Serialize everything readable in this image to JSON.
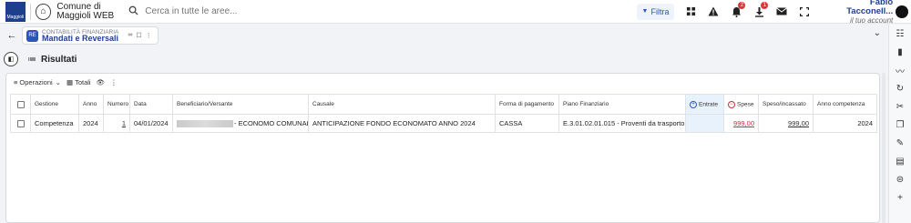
{
  "topbar": {
    "logo_text": "Maggioli",
    "app_title_line1": "Comune di",
    "app_title_line2": "Maggioli WEB",
    "search_placeholder": "Cerca in tutte le aree...",
    "filter_label": "Filtra",
    "notifications_badge": "2",
    "downloads_badge": "1",
    "user_name": "Fabio Tacconell...",
    "user_account": "il tuo account"
  },
  "tab": {
    "avatar": "RE",
    "subtitle": "CONTABILITÀ FINANZIARIA",
    "title": "Mandati e Reversali"
  },
  "results": {
    "title": "Risultati"
  },
  "toolbar": {
    "operations_label": "Operazioni",
    "totals_label": "Totali"
  },
  "table": {
    "headers": {
      "gestione": "Gestione",
      "anno": "Anno",
      "numero": "Numero",
      "data": "Data",
      "beneficiario": "Beneficiario/Versante",
      "causale": "Causale",
      "forma": "Forma di pagamento",
      "piano": "Piano Finanziario",
      "entrate": "Entrate",
      "spese": "Spese",
      "speso": "Speso/incassato",
      "anno_comp": "Anno competenza"
    },
    "rows": [
      {
        "gestione": "Competenza",
        "anno": "2024",
        "numero": "1",
        "data": "04/01/2024",
        "beneficiario": "- ECONOMO COMUNALE",
        "causale": "ANTICIPAZIONE FONDO ECONOMATO ANNO 2024",
        "forma": "CASSA",
        "piano": "E.3.01.02.01.015 - Proventi da trasporto",
        "entrate": "",
        "spese": "999,00",
        "speso": "999,00",
        "anno_comp": "2024"
      }
    ]
  }
}
